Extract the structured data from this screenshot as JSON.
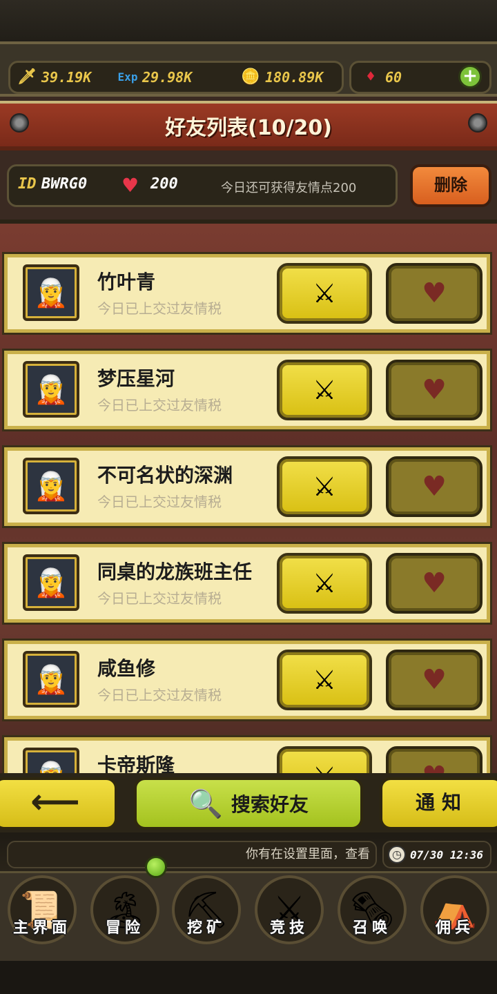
{
  "resources": {
    "attack": {
      "icon": "sword-icon",
      "value": "39.19K"
    },
    "exp": {
      "icon": "exp-icon",
      "value": "29.98K"
    },
    "gold": {
      "icon": "gold-coin-icon",
      "value": "180.89K"
    },
    "gems": {
      "icon": "ruby-icon",
      "value": "60"
    }
  },
  "header": {
    "title": "好友列表(10/20)"
  },
  "user_bar": {
    "id_label": "ID",
    "id_value": "BWRG0",
    "hearts": "200",
    "today_text": "今日还可获得友情点200",
    "delete_label": "删除"
  },
  "friends": [
    {
      "name": "竹叶青",
      "status": "今日已上交过友情税"
    },
    {
      "name": "梦压星河",
      "status": "今日已上交过友情税"
    },
    {
      "name": "不可名状的深渊",
      "status": "今日已上交过友情税"
    },
    {
      "name": "同桌的龙族班主任",
      "status": "今日已上交过友情税"
    },
    {
      "name": "咸鱼修",
      "status": "今日已上交过友情税"
    },
    {
      "name": "卡帝斯隆",
      "status": ""
    }
  ],
  "actions": {
    "back_label": "⟵",
    "search_label": "搜索好友",
    "notify_label": "通知"
  },
  "ticker": {
    "text": "你有在设置里面，查看"
  },
  "clock": {
    "text": "07/30 12:36"
  },
  "nav": [
    {
      "label": "主界面",
      "icon": "map-scroll-icon"
    },
    {
      "label": "冒险",
      "icon": "island-icon"
    },
    {
      "label": "挖矿",
      "icon": "pickaxe-icon"
    },
    {
      "label": "竞技",
      "icon": "crossed-swords-icon"
    },
    {
      "label": "召唤",
      "icon": "summon-scroll-icon"
    },
    {
      "label": "佣兵",
      "icon": "tent-icon"
    }
  ],
  "colors": {
    "gold_text": "#e9c64b",
    "banner_red": "#9b3a24",
    "row_bg": "#f6ebb4",
    "button_yellow": "#e2cc2a",
    "button_green": "#b6d232"
  }
}
